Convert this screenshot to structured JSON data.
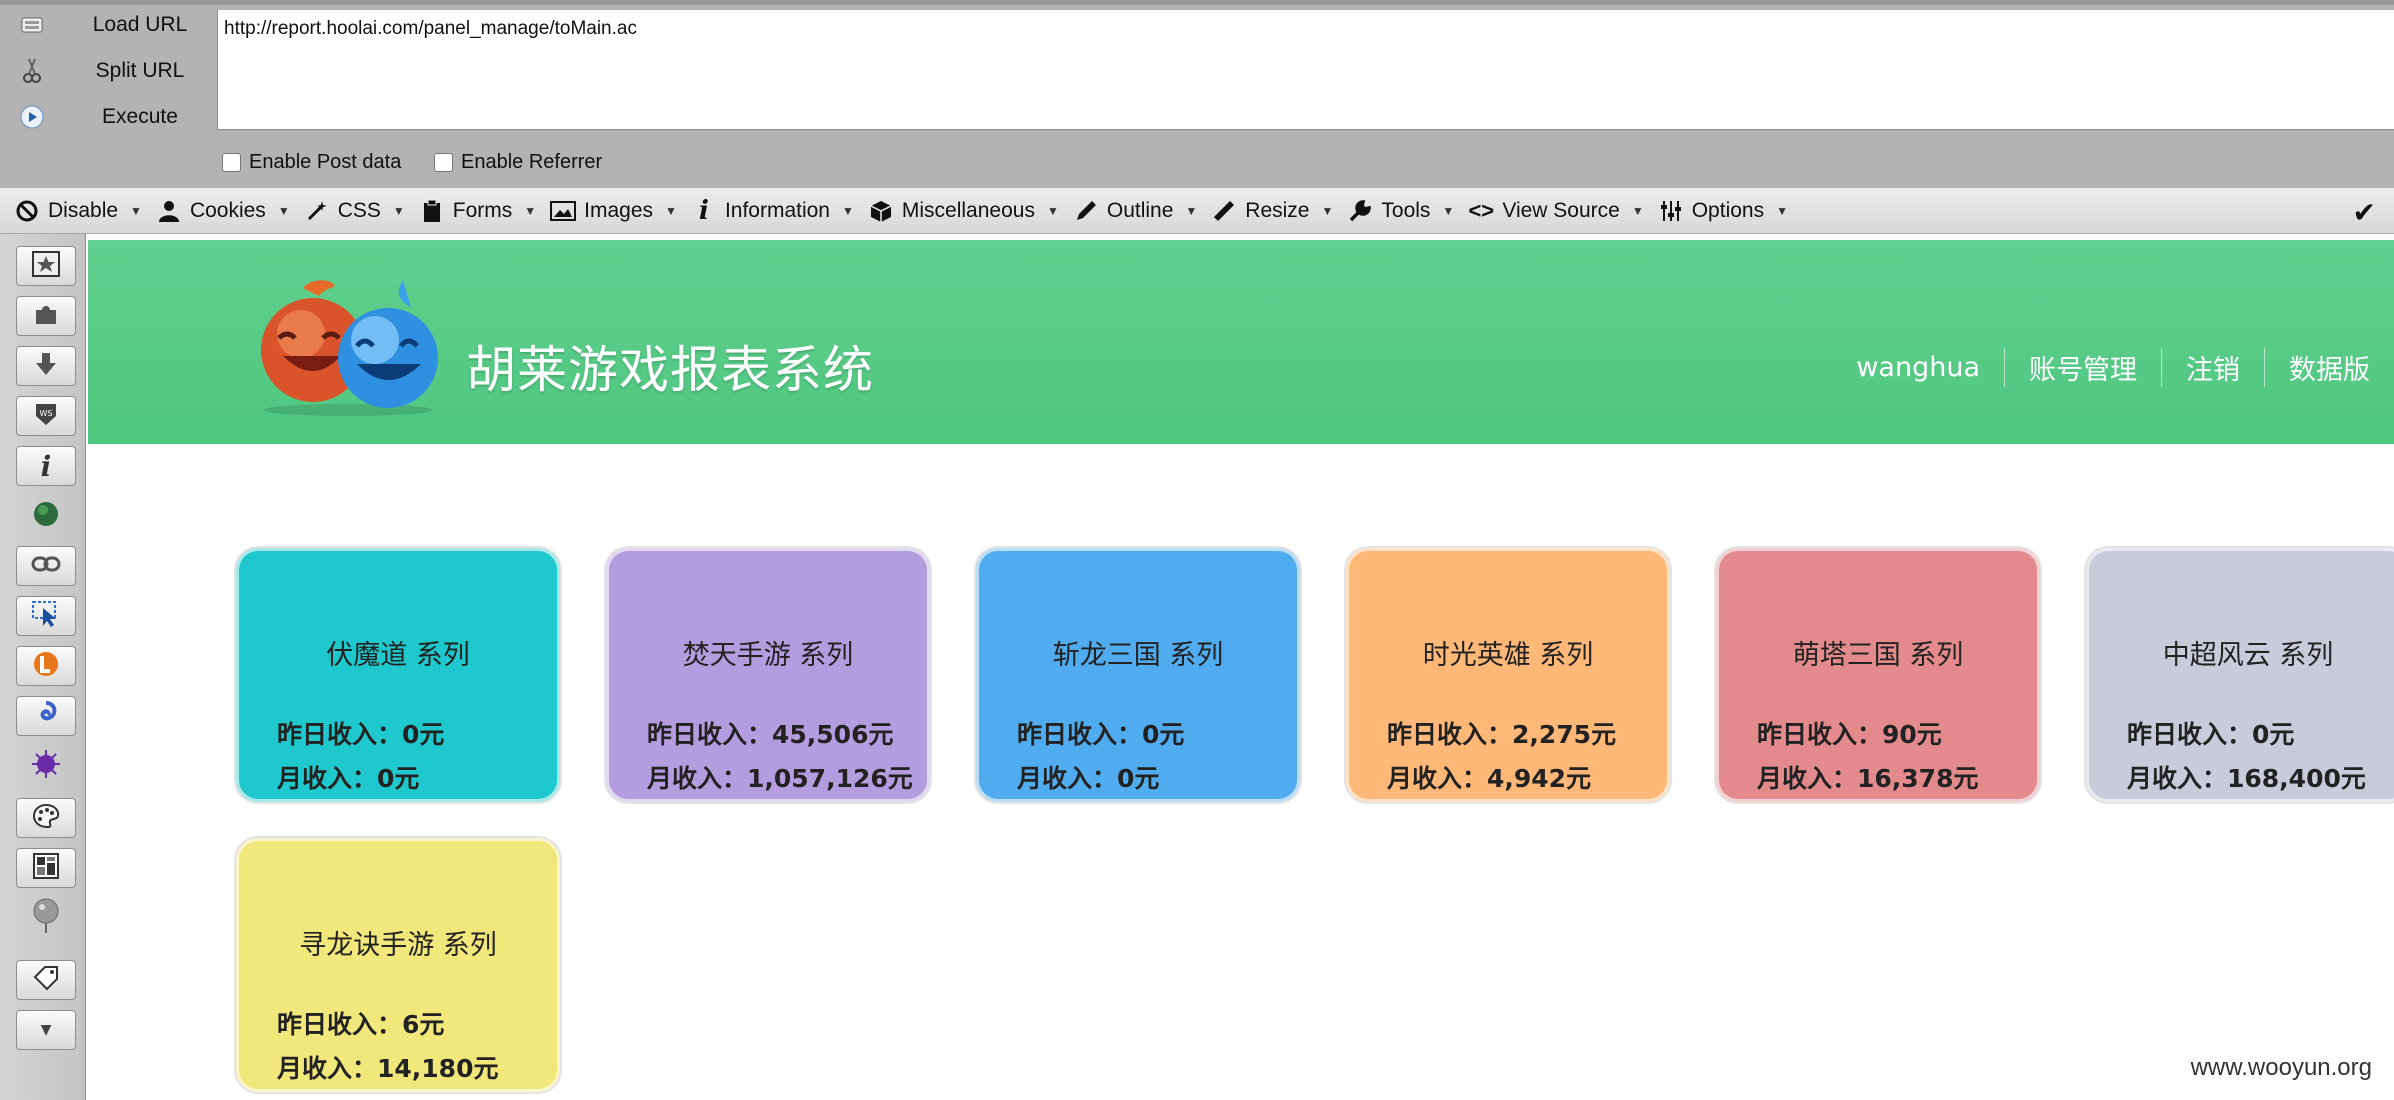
{
  "hackbar": {
    "load_url": "Load URL",
    "split_url": "Split URL",
    "execute": "Execute",
    "url": "http://report.hoolai.com/panel_manage/toMain.ac",
    "enable_post": "Enable Post data",
    "enable_referrer": "Enable Referrer"
  },
  "devbar": {
    "items": [
      "Disable",
      "Cookies",
      "CSS",
      "Forms",
      "Images",
      "Information",
      "Miscellaneous",
      "Outline",
      "Resize",
      "Tools",
      "View Source",
      "Options"
    ]
  },
  "header": {
    "title": "胡莱游戏报表系统",
    "nav": [
      "wanghua",
      "账号管理",
      "注销",
      "数据版"
    ]
  },
  "cards": [
    {
      "title": "伏魔道 系列",
      "yesterday": "昨日收入：0元",
      "month": "月收入：0元",
      "color": "#1ec8cc"
    },
    {
      "title": "焚天手游 系列",
      "yesterday": "昨日收入：45,506元",
      "month": "月收入：1,057,126元",
      "color": "#b39ddf"
    },
    {
      "title": "斩龙三国 系列",
      "yesterday": "昨日收入：0元",
      "month": "月收入：0元",
      "color": "#50acef"
    },
    {
      "title": "时光英雄 系列",
      "yesterday": "昨日收入：2,275元",
      "month": "月收入：4,942元",
      "color": "#ffb877"
    },
    {
      "title": "萌塔三国 系列",
      "yesterday": "昨日收入：90元",
      "month": "月收入：16,378元",
      "color": "#e28a8c"
    },
    {
      "title": "中超风云 系列",
      "yesterday": "昨日收入：0元",
      "month": "月收入：168,400元",
      "color": "#c8ccda"
    },
    {
      "title": "寻龙诀手游 系列",
      "yesterday": "昨日收入：6元",
      "month": "月收入：14,180元",
      "color": "#f2e77a"
    }
  ],
  "watermark": "www.wooyun.org"
}
